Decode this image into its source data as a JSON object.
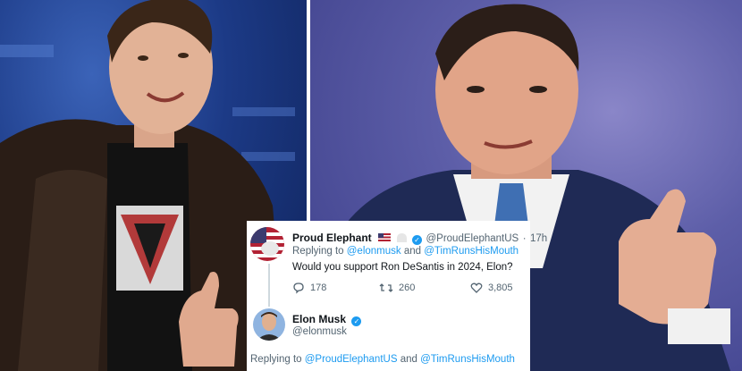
{
  "tweet1": {
    "name": "Proud Elephant",
    "handle": "@ProudElephantUS",
    "time": "17h",
    "replying_prefix": "Replying to",
    "replying_user1": "@elonmusk",
    "replying_and": "and",
    "replying_user2": "@TimRunsHisMouth",
    "text": "Would you support Ron DeSantis in 2024, Elon?",
    "reply_count": "178",
    "retweet_count": "260",
    "like_count": "3,805",
    "name_emoji_icons": [
      "us-flag-icon",
      "capitol-icon"
    ]
  },
  "tweet2": {
    "name": "Elon Musk",
    "handle": "@elonmusk",
    "replying_prefix": "Replying to",
    "replying_user1": "@ProudElephantUS",
    "replying_and": "and",
    "replying_user2": "@TimRunsHisMouth"
  },
  "colors": {
    "link": "#1d9bf0",
    "muted": "#536471",
    "card_bg": "#ffffff",
    "left_photo_bg": "#1c3a86",
    "right_photo_bg": "#5d5ea8"
  }
}
